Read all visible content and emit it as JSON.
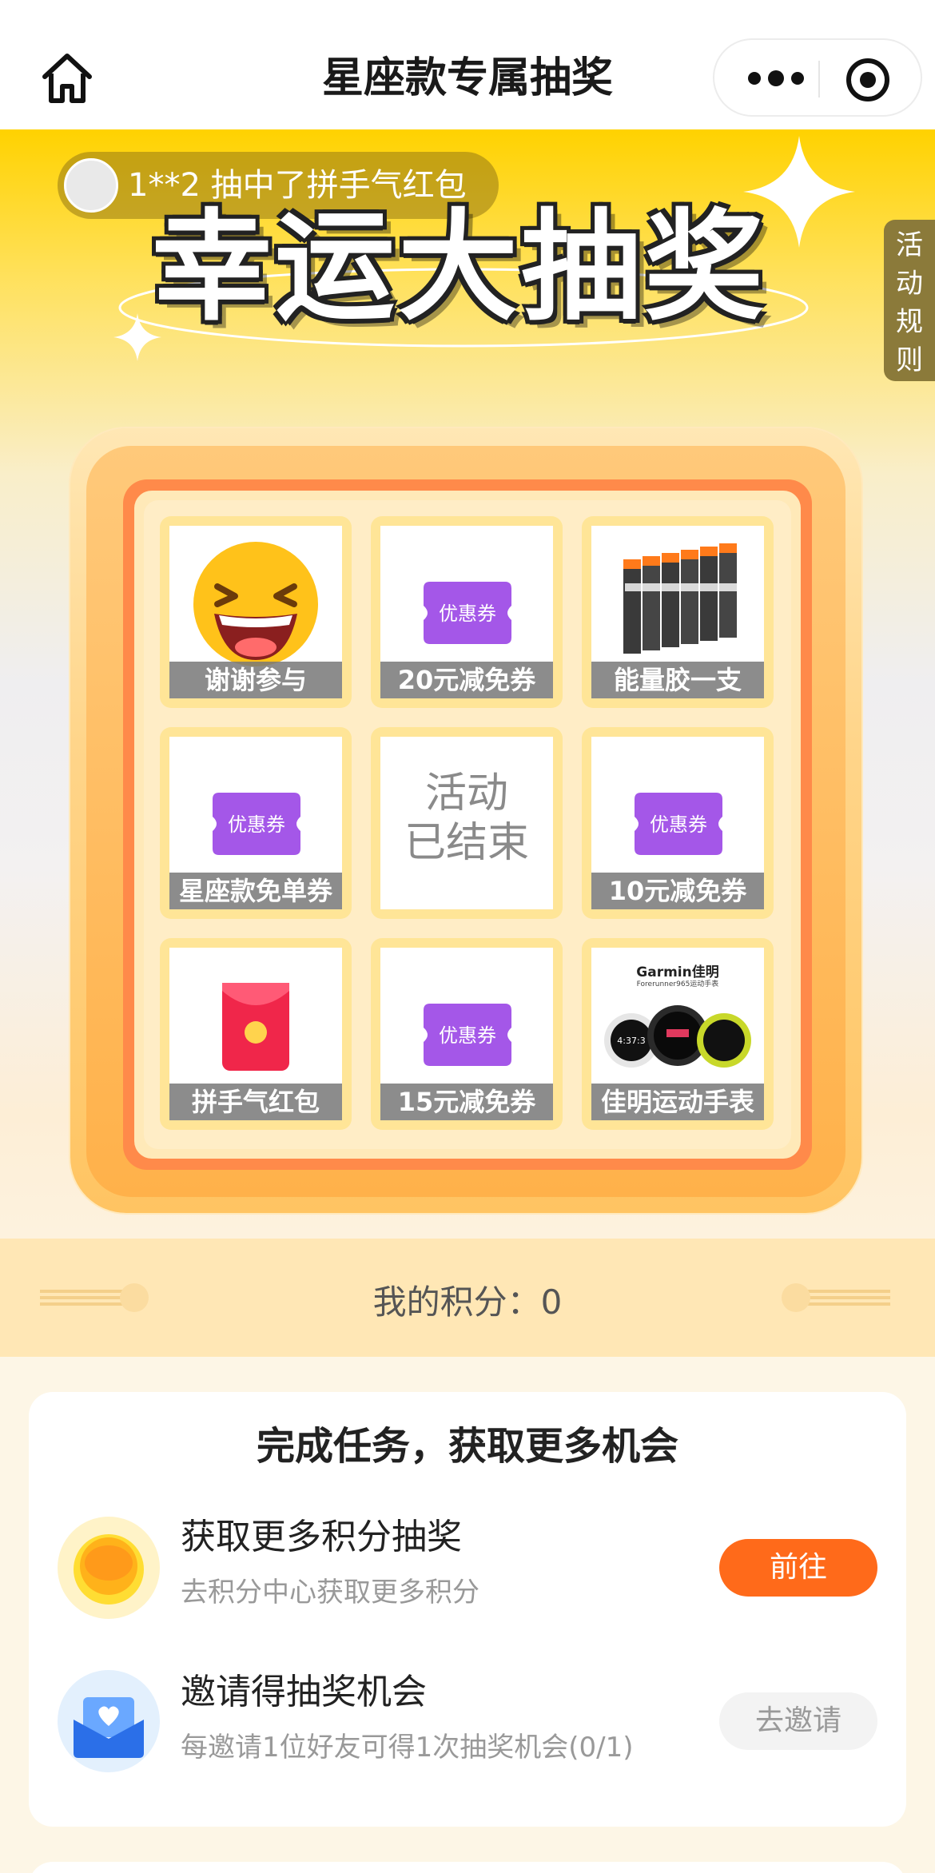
{
  "nav": {
    "title": "星座款专属抽奖",
    "home_icon": "home-icon",
    "more_icon": "more-dots-icon",
    "close_icon": "target-circle-icon"
  },
  "hero": {
    "ticker_text": "1**2  抽中了拼手气红包",
    "title": "幸运大抽奖",
    "rules_label": [
      "活",
      "动",
      "规",
      "则"
    ]
  },
  "grid": {
    "cells": [
      {
        "label": "谢谢参与",
        "icon": "laughing-emoji-icon"
      },
      {
        "label": "20元减免券",
        "icon": "coupon-icon",
        "coupon_text": "优惠券"
      },
      {
        "label": "能量胶一支",
        "icon": "energy-gel-image"
      },
      {
        "label": "星座款免单券",
        "icon": "coupon-icon",
        "coupon_text": "优惠券"
      },
      {
        "label": "活动\n已结束",
        "icon": ""
      },
      {
        "label": "10元减免券",
        "icon": "coupon-icon",
        "coupon_text": "优惠券"
      },
      {
        "label": "拼手气红包",
        "icon": "red-envelope-icon"
      },
      {
        "label": "15元减免券",
        "icon": "coupon-icon",
        "coupon_text": "优惠券"
      },
      {
        "label": "佳明运动手表",
        "icon": "garmin-watch-image",
        "brand_text": "Garmin佳明",
        "sub_text": "Forerunner965运动手表",
        "watch_time": "4:37:3"
      }
    ],
    "center_line1": "活动",
    "center_line2": "已结束"
  },
  "points": {
    "label": "我的积分：0"
  },
  "tasks": {
    "title": "完成任务，获取更多机会",
    "items": [
      {
        "name": "获取更多积分抽奖",
        "desc": "去积分中心获取更多积分",
        "button": "前往",
        "icon": "coin-icon"
      },
      {
        "name": "邀请得抽奖机会",
        "desc": "每邀请1位好友可得1次抽奖机会(0/1)",
        "button": "去邀请",
        "icon": "invite-envelope-icon"
      }
    ]
  },
  "colors": {
    "accent": "#ff6a1a",
    "hero_yellow": "#ffd200",
    "coupon_purple": "#a457e8",
    "frame_orange": "#ff8a4a"
  }
}
